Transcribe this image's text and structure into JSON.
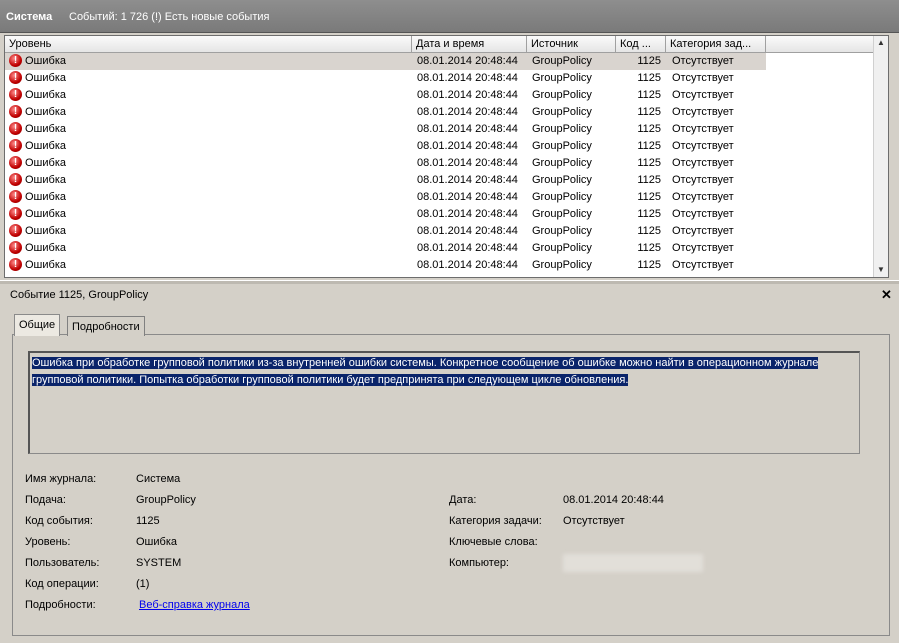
{
  "header": {
    "title": "Система",
    "events_info": "Событий: 1 726 (!) Есть новые события"
  },
  "grid": {
    "columns": [
      "Уровень",
      "Дата и время",
      "Источник",
      "Код ...",
      "Категория зад..."
    ],
    "rows": [
      {
        "level": "Ошибка",
        "datetime": "08.01.2014 20:48:44",
        "source": "GroupPolicy",
        "code": "1125",
        "category": "Отсутствует"
      },
      {
        "level": "Ошибка",
        "datetime": "08.01.2014 20:48:44",
        "source": "GroupPolicy",
        "code": "1125",
        "category": "Отсутствует"
      },
      {
        "level": "Ошибка",
        "datetime": "08.01.2014 20:48:44",
        "source": "GroupPolicy",
        "code": "1125",
        "category": "Отсутствует"
      },
      {
        "level": "Ошибка",
        "datetime": "08.01.2014 20:48:44",
        "source": "GroupPolicy",
        "code": "1125",
        "category": "Отсутствует"
      },
      {
        "level": "Ошибка",
        "datetime": "08.01.2014 20:48:44",
        "source": "GroupPolicy",
        "code": "1125",
        "category": "Отсутствует"
      },
      {
        "level": "Ошибка",
        "datetime": "08.01.2014 20:48:44",
        "source": "GroupPolicy",
        "code": "1125",
        "category": "Отсутствует"
      },
      {
        "level": "Ошибка",
        "datetime": "08.01.2014 20:48:44",
        "source": "GroupPolicy",
        "code": "1125",
        "category": "Отсутствует"
      },
      {
        "level": "Ошибка",
        "datetime": "08.01.2014 20:48:44",
        "source": "GroupPolicy",
        "code": "1125",
        "category": "Отсутствует"
      },
      {
        "level": "Ошибка",
        "datetime": "08.01.2014 20:48:44",
        "source": "GroupPolicy",
        "code": "1125",
        "category": "Отсутствует"
      },
      {
        "level": "Ошибка",
        "datetime": "08.01.2014 20:48:44",
        "source": "GroupPolicy",
        "code": "1125",
        "category": "Отсутствует"
      },
      {
        "level": "Ошибка",
        "datetime": "08.01.2014 20:48:44",
        "source": "GroupPolicy",
        "code": "1125",
        "category": "Отсутствует"
      },
      {
        "level": "Ошибка",
        "datetime": "08.01.2014 20:48:44",
        "source": "GroupPolicy",
        "code": "1125",
        "category": "Отсутствует"
      },
      {
        "level": "Ошибка",
        "datetime": "08.01.2014 20:48:44",
        "source": "GroupPolicy",
        "code": "1125",
        "category": "Отсутствует"
      }
    ],
    "icon": "error-icon"
  },
  "detail": {
    "title": "Событие 1125, GroupPolicy",
    "close_icon": "close-icon",
    "tabs": [
      "Общие",
      "Подробности"
    ],
    "message": "Ошибка при обработке групповой политики из-за внутренней ошибки системы. Конкретное сообщение об ошибке можно найти в операционном журнале групповой политики. Попытка обработки групповой политики будет предпринята при следующем цикле обновления.",
    "fields": {
      "log_name_label": "Имя журнала:",
      "log_name": "Система",
      "source_label": "Подача:",
      "source": "GroupPolicy",
      "event_id_label": "Код события:",
      "event_id": "1125",
      "level_label": "Уровень:",
      "level": "Ошибка",
      "user_label": "Пользователь:",
      "user": "SYSTEM",
      "opcode_label": "Код операции:",
      "opcode": "(1)",
      "more_info_label": "Подробности:",
      "more_info_link": "Веб-справка журнала",
      "date_label": "Дата:",
      "date": "08.01.2014 20:48:44",
      "task_category_label": "Категория задачи:",
      "task_category": "Отсутствует",
      "keywords_label": "Ключевые слова:",
      "computer_label": "Компьютер:"
    }
  },
  "colors": {
    "selection": "#0a246a",
    "link": "#0000ee",
    "error": "#c00000"
  }
}
